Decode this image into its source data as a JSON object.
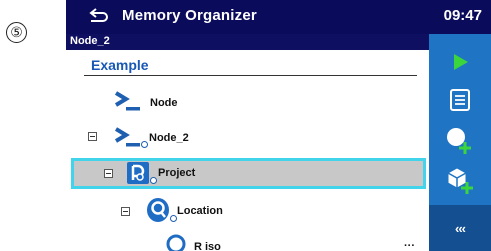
{
  "step_marker": "⑤",
  "header": {
    "title": "Memory Organizer",
    "time": "09:47"
  },
  "path": "Node_2",
  "tree": {
    "root": "Example",
    "items": [
      {
        "label": "Node",
        "level": 0,
        "type": "node"
      },
      {
        "label": "Node_2",
        "level": 0,
        "type": "node",
        "expanded": true
      },
      {
        "label": "Project",
        "level": 1,
        "type": "project",
        "expanded": true,
        "selected": true
      },
      {
        "label": "Location",
        "level": 2,
        "type": "location",
        "expanded": true
      },
      {
        "label": "R iso",
        "level": 3,
        "type": "measurement"
      }
    ]
  },
  "sidebar": {
    "buttons": [
      "play-icon",
      "details-icon",
      "add-measurement-icon",
      "add-structure-icon"
    ],
    "more_label": "‹‹‹"
  },
  "colors": {
    "titlebar": "#0b0b5c",
    "sidebar": "#1f74c4",
    "selection_border": "#41d4ea",
    "accent_green": "#3bd63b"
  }
}
